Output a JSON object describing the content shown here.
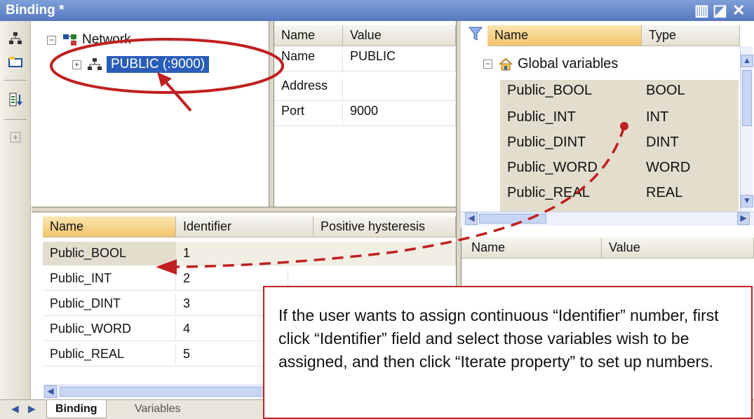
{
  "window": {
    "title": "Binding *"
  },
  "tree": {
    "root_label": "Network",
    "child_label": "PUBLIC (:9000)"
  },
  "properties": {
    "headers": [
      "Name",
      "Value"
    ],
    "rows": [
      {
        "name": "Name",
        "value": "PUBLIC"
      },
      {
        "name": "Address",
        "value": ""
      },
      {
        "name": "Port",
        "value": "9000"
      }
    ]
  },
  "variables_panel": {
    "headers": [
      "Name",
      "Type"
    ],
    "group_label": "Global variables",
    "rows": [
      {
        "name": "Public_BOOL",
        "type": "BOOL"
      },
      {
        "name": "Public_INT",
        "type": "INT"
      },
      {
        "name": "Public_DINT",
        "type": "DINT"
      },
      {
        "name": "Public_WORD",
        "type": "WORD"
      },
      {
        "name": "Public_REAL",
        "type": "REAL"
      }
    ]
  },
  "detail_panel": {
    "headers": [
      "Name",
      "Value"
    ]
  },
  "binding_grid": {
    "headers": [
      "Name",
      "Identifier",
      "Positive hysteresis"
    ],
    "rows": [
      {
        "name": "Public_BOOL",
        "id": "1"
      },
      {
        "name": "Public_INT",
        "id": "2"
      },
      {
        "name": "Public_DINT",
        "id": "3"
      },
      {
        "name": "Public_WORD",
        "id": "4"
      },
      {
        "name": "Public_REAL",
        "id": "5"
      }
    ]
  },
  "tabs": {
    "binding": "Binding",
    "variables": "Variables"
  },
  "callout": {
    "text": "If the user wants to assign continuous “Identifier” number, first click “Identifier” field and select those variables wish to be assigned, and then click “Iterate property” to set up numbers."
  },
  "colors": {
    "annotation_red": "#c02020",
    "selection_blue": "#2a5db8",
    "title_blue": "#5678c0"
  }
}
